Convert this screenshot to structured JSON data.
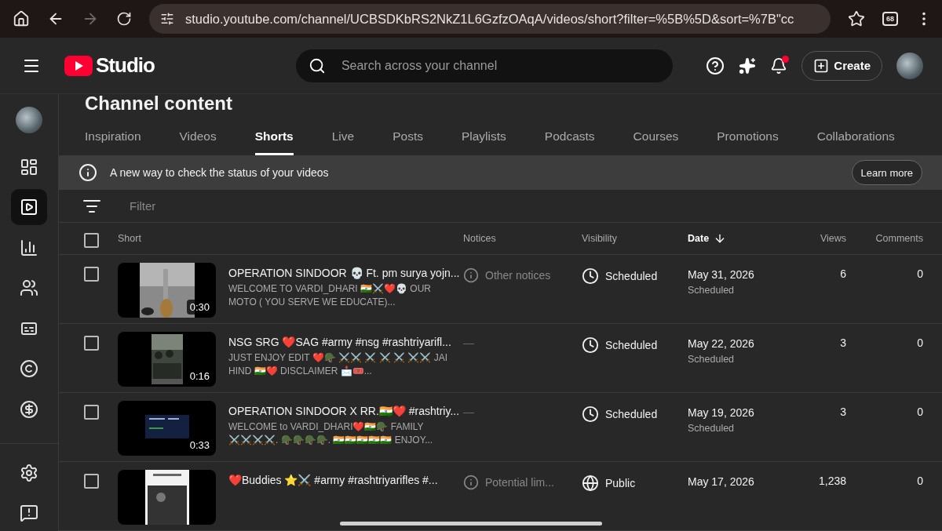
{
  "browser": {
    "url": "studio.youtube.com/channel/UCBSDKbRS2NkZ1L6GzfzOAqA/videos/short?filter=%5B%5D&sort=%7B\"cc",
    "tab_count": "68"
  },
  "header": {
    "logo": "Studio",
    "search": {
      "placeholder": "Search across your channel"
    },
    "create": "Create"
  },
  "sidebar": {
    "items": [
      {
        "kind": "dashboard",
        "selected": false
      },
      {
        "kind": "content",
        "selected": true
      },
      {
        "kind": "analytics",
        "selected": false
      },
      {
        "kind": "community",
        "selected": false
      },
      {
        "kind": "subtitles",
        "selected": false
      },
      {
        "kind": "copyright",
        "selected": false
      },
      {
        "kind": "earn",
        "selected": false
      }
    ],
    "bottom": [
      {
        "kind": "settings",
        "selected": false
      },
      {
        "kind": "feedback",
        "selected": false
      }
    ]
  },
  "page_title": "Channel content",
  "tabs": [
    {
      "label": "Inspiration",
      "selected": false
    },
    {
      "label": "Videos",
      "selected": false
    },
    {
      "label": "Shorts",
      "selected": true
    },
    {
      "label": "Live",
      "selected": false
    },
    {
      "label": "Posts",
      "selected": false
    },
    {
      "label": "Playlists",
      "selected": false
    },
    {
      "label": "Podcasts",
      "selected": false
    },
    {
      "label": "Courses",
      "selected": false
    },
    {
      "label": "Promotions",
      "selected": false
    },
    {
      "label": "Collaborations",
      "selected": false
    }
  ],
  "banner": {
    "text": "A new way to check the status of your videos",
    "button": "Learn more"
  },
  "filter": {
    "placeholder": "Filter"
  },
  "table": {
    "select_all": {
      "checked": false
    },
    "columns": [
      "Short",
      "Notices",
      "Visibility",
      "Date",
      "Views",
      "Comments"
    ],
    "rows": [
      {
        "checked": false,
        "duration": "0:30",
        "title": "OPERATION SINDOOR 💀 Ft. pm surya yojn...",
        "description": "WELCOME TO VARDI_DHARI 🇮🇳⚔️❤️💀 OUR MOTO ( YOU SERVE WE EDUCATE)...",
        "notice": {
          "kind": "info",
          "text": "Other notices"
        },
        "visibility": {
          "kind": "scheduled",
          "text": "Scheduled"
        },
        "date": "May 31, 2026",
        "date_status": "Scheduled",
        "views": "6",
        "comments": "0"
      },
      {
        "checked": false,
        "duration": "0:16",
        "title": "NSG SRG ❤️SAG #army #nsg #rashtriyarifl...",
        "description": "JUST ENJOY EDIT ❤️🪖 ⚔️⚔️ ⚔️ ⚔️ ⚔️ ⚔️⚔️ JAI HIND 🇮🇳❤️ DISCLAIMER 📩🎟️...",
        "notice": {
          "kind": "none",
          "text": "—"
        },
        "visibility": {
          "kind": "scheduled",
          "text": "Scheduled"
        },
        "date": "May 22, 2026",
        "date_status": "Scheduled",
        "views": "3",
        "comments": "0"
      },
      {
        "checked": false,
        "duration": "0:33",
        "title": "OPERATION SINDOOR X RR.🇮🇳❤️ #rashtriy...",
        "description": "WELCOME to VARDI_DHARI❤️🇮🇳🪖 FAMILY ⚔️⚔️⚔️⚔️. 🪖🪖🪖🪖. 🇮🇳🇮🇳🇮🇳🇮🇳🇮🇳 ENJOY...",
        "notice": {
          "kind": "none",
          "text": "—"
        },
        "visibility": {
          "kind": "scheduled",
          "text": "Scheduled"
        },
        "date": "May 19, 2026",
        "date_status": "Scheduled",
        "views": "3",
        "comments": "0"
      },
      {
        "checked": false,
        "title": "❤️Buddies ⭐⚔️ #army #rashtriyarifles #...",
        "notice": {
          "kind": "info",
          "text": "Potential lim..."
        },
        "visibility": {
          "kind": "public",
          "text": "Public"
        },
        "date": "May 17, 2026",
        "views": "1,238",
        "comments": "0"
      }
    ]
  }
}
